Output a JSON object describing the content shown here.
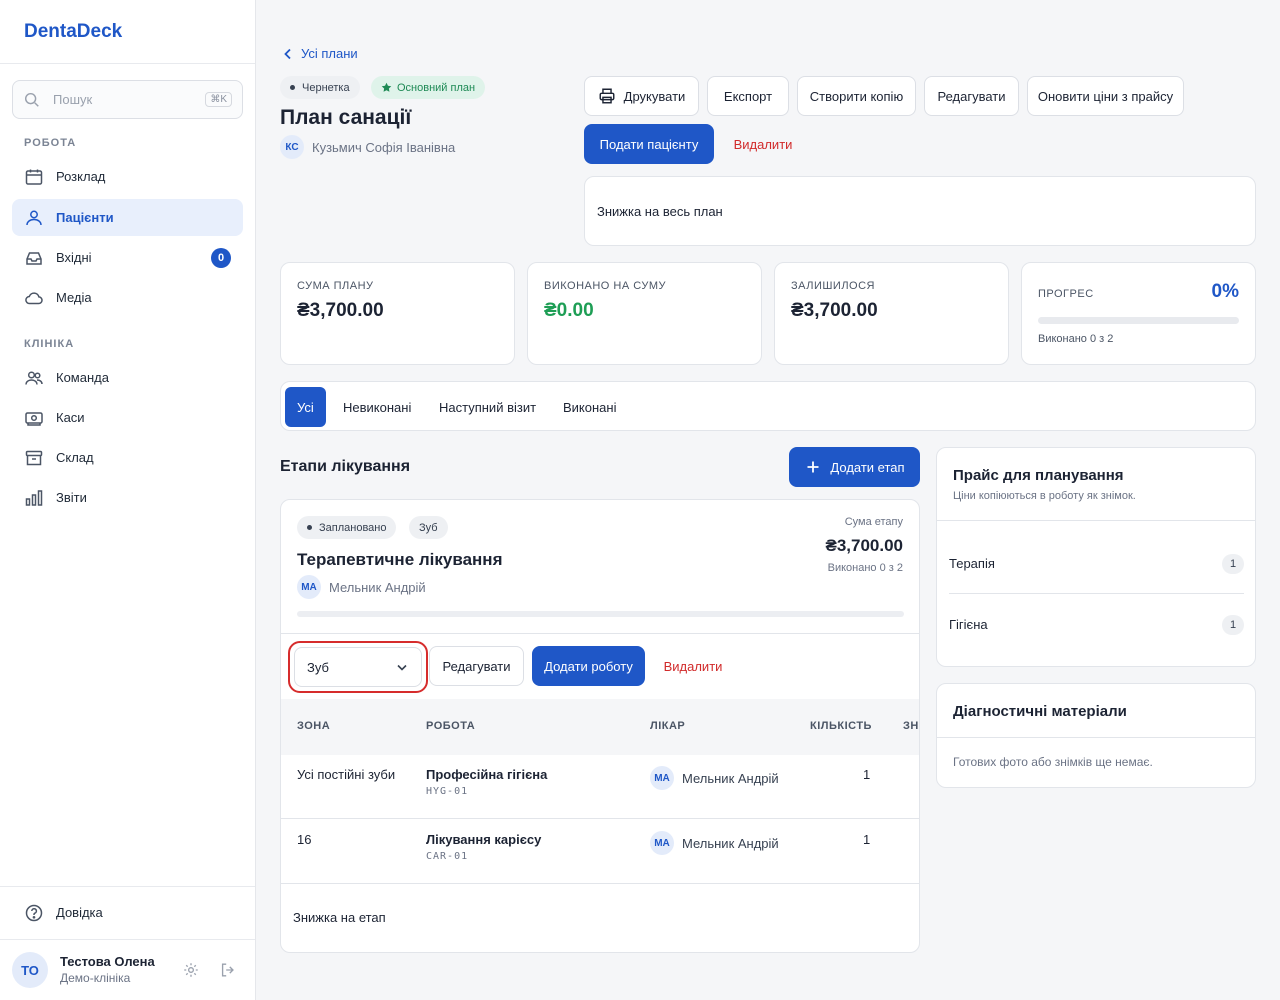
{
  "app": {
    "name": "DentaDeck"
  },
  "search": {
    "placeholder": "Пошук",
    "shortcut": "⌘K"
  },
  "sidebar": {
    "section_work": "РОБОТА",
    "section_clinic": "КЛІНІКА",
    "work_items": [
      {
        "label": "Розклад",
        "icon": "calendar-icon"
      },
      {
        "label": "Пацієнти",
        "icon": "users-icon",
        "active": true
      },
      {
        "label": "Вхідні",
        "icon": "inbox-icon",
        "badge": "0"
      },
      {
        "label": "Медіа",
        "icon": "cloud-icon"
      }
    ],
    "clinic_items": [
      {
        "label": "Команда",
        "icon": "team-icon"
      },
      {
        "label": "Каси",
        "icon": "cash-icon"
      },
      {
        "label": "Склад",
        "icon": "archive-icon"
      },
      {
        "label": "Звіти",
        "icon": "chart-icon"
      }
    ],
    "help": "Довідка",
    "user": {
      "initials": "ТО",
      "name": "Тестова Олена",
      "clinic": "Демо-клініка"
    }
  },
  "header": {
    "back": "Усі плани",
    "status": "Чернетка",
    "main_plan": "Основний план",
    "title": "План санації",
    "patient_initials": "КС",
    "patient_name": "Кузьмич Софія Іванівна"
  },
  "actions": {
    "print": "Друкувати",
    "export": "Експорт",
    "copy": "Створити копію",
    "edit": "Редагувати",
    "update_prices": "Оновити ціни з прайсу",
    "submit": "Подати пацієнту",
    "delete": "Видалити"
  },
  "plan_discount": "Знижка на весь план",
  "stats": {
    "total_label": "СУМА ПЛАНУ",
    "total": "₴3,700.00",
    "done_label": "ВИКОНАНО НА СУМУ",
    "done": "₴0.00",
    "left_label": "ЗАЛИШИЛОСЯ",
    "left": "₴3,700.00",
    "progress_label": "ПРОГРЕС",
    "progress": "0%",
    "progress_fraction": 0,
    "progress_note": "Виконано 0 з 2"
  },
  "tabs": [
    "Усі",
    "Невиконані",
    "Наступний візит",
    "Виконані"
  ],
  "stages_section": {
    "title": "Етапи лікування",
    "add": "Додати етап"
  },
  "stage": {
    "status": "Заплановано",
    "tag": "Зуб",
    "title": "Терапевтичне лікування",
    "doctor_initials": "МА",
    "doctor": "Мельник Андрій",
    "sum_label": "Сума етапу",
    "sum": "₴3,700.00",
    "done": "Виконано 0 з 2",
    "select_value": "Зуб",
    "edit": "Редагувати",
    "add_work": "Додати роботу",
    "delete": "Видалити",
    "columns": [
      "ЗОНА",
      "РОБОТА",
      "ЛІКАР",
      "КІЛЬКІСТЬ",
      "ЗН"
    ],
    "rows": [
      {
        "zone": "Усі постійні зуби",
        "work": "Професійна гігієна",
        "code": "HYG-01",
        "doctor_initials": "МА",
        "doctor": "Мельник Андрій",
        "qty": "1"
      },
      {
        "zone": "16",
        "work": "Лікування карієсу",
        "code": "CAR-01",
        "doctor_initials": "МА",
        "doctor": "Мельник Андрій",
        "qty": "1"
      }
    ],
    "discount": "Знижка на етап"
  },
  "price_panel": {
    "title": "Прайс для планування",
    "subtitle": "Ціни копіюються в роботу як знімок.",
    "items": [
      {
        "label": "Терапія",
        "count": "1"
      },
      {
        "label": "Гігієна",
        "count": "1"
      }
    ]
  },
  "diag_panel": {
    "title": "Діагностичні матеріали",
    "empty": "Готових фото або знімків ще немає."
  }
}
